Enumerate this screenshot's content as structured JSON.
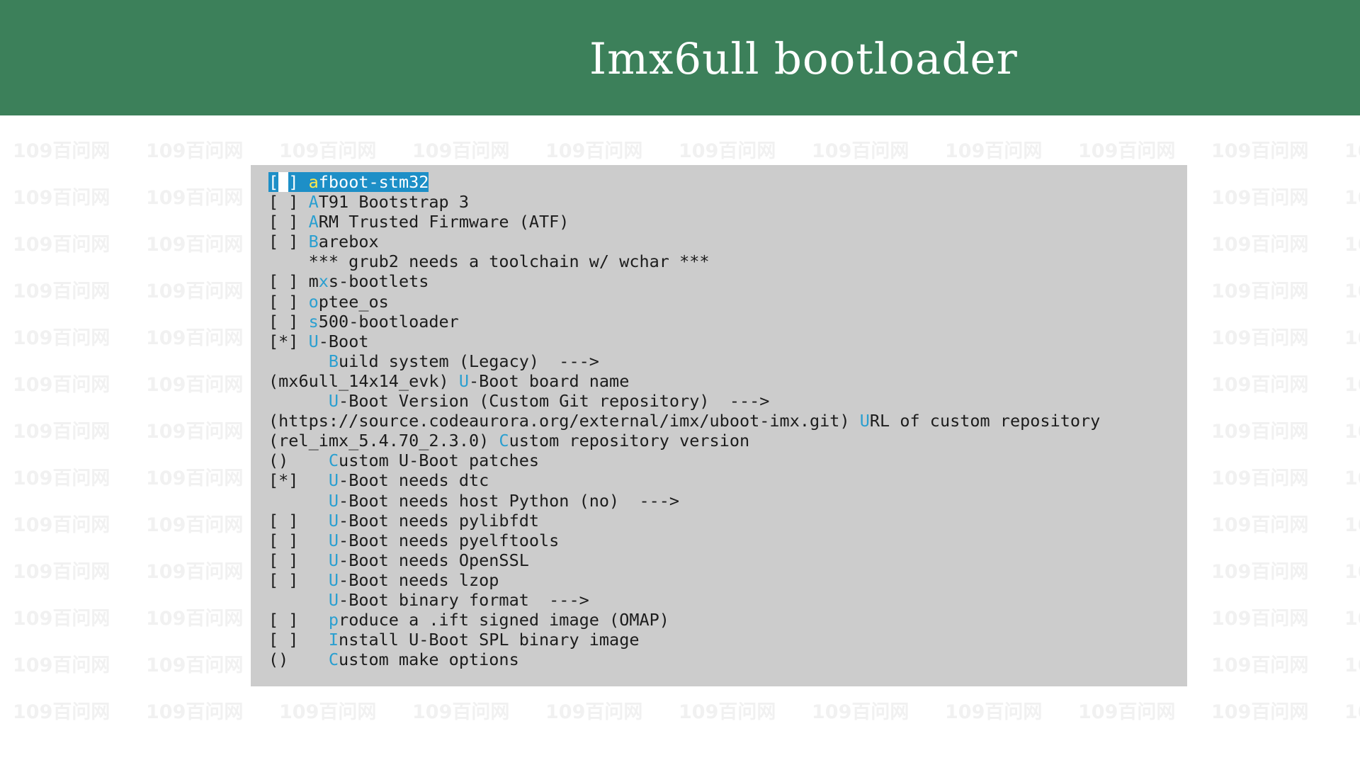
{
  "header": {
    "title": "Imx6ull bootloader",
    "background_color": "#3c805a"
  },
  "watermark": {
    "text": "109百问网"
  },
  "terminal": {
    "background_color": "#cccccc",
    "hotkey_color": "#2a9fd0",
    "selection_color": "#1d8fc7",
    "items": [
      {
        "prefix": "[ ] ",
        "hot": "a",
        "rest": "fboot-stm32",
        "selected": true
      },
      {
        "prefix": "[ ] ",
        "hot": "A",
        "rest": "T91 Bootstrap 3"
      },
      {
        "prefix": "[ ] ",
        "hot": "A",
        "rest": "RM Trusted Firmware (ATF)"
      },
      {
        "prefix": "[ ] ",
        "hot": "B",
        "rest": "arebox"
      },
      {
        "prefix": "    ",
        "hot": "",
        "rest": "*** grub2 needs a toolchain w/ wchar ***"
      },
      {
        "prefix": "[ ] ",
        "hot": "",
        "pre": "m",
        "hot2": "x",
        "rest": "s-bootlets"
      },
      {
        "prefix": "[ ] ",
        "hot": "o",
        "rest": "ptee_os"
      },
      {
        "prefix": "[ ] ",
        "hot": "s",
        "rest": "500-bootloader"
      },
      {
        "prefix": "[*] ",
        "hot": "U",
        "rest": "-Boot"
      },
      {
        "prefix": "      ",
        "hot": "B",
        "rest": "uild system (Legacy)  --->"
      },
      {
        "prefix": "(mx6ull_14x14_evk) ",
        "hot": "U",
        "rest": "-Boot board name"
      },
      {
        "prefix": "      ",
        "hot": "U",
        "rest": "-Boot Version (Custom Git repository)  --->"
      },
      {
        "prefix": "(https://source.codeaurora.org/external/imx/uboot-imx.git) ",
        "hot": "U",
        "rest": "RL of custom repository"
      },
      {
        "prefix": "(rel_imx_5.4.70_2.3.0) ",
        "hot": "C",
        "rest": "ustom repository version"
      },
      {
        "prefix": "()    ",
        "hot": "C",
        "rest": "ustom U-Boot patches"
      },
      {
        "prefix": "[*]   ",
        "hot": "U",
        "rest": "-Boot needs dtc"
      },
      {
        "prefix": "      ",
        "hot": "U",
        "rest": "-Boot needs host Python (no)  --->"
      },
      {
        "prefix": "[ ]   ",
        "hot": "U",
        "rest": "-Boot needs pylibfdt"
      },
      {
        "prefix": "[ ]   ",
        "hot": "U",
        "rest": "-Boot needs pyelftools"
      },
      {
        "prefix": "[ ]   ",
        "hot": "U",
        "rest": "-Boot needs OpenSSL"
      },
      {
        "prefix": "[ ]   ",
        "hot": "U",
        "rest": "-Boot needs lzop"
      },
      {
        "prefix": "      ",
        "hot": "U",
        "rest": "-Boot binary format  --->"
      },
      {
        "prefix": "[ ]   ",
        "hot": "p",
        "rest": "roduce a .ift signed image (OMAP)"
      },
      {
        "prefix": "[ ]   ",
        "hot": "I",
        "rest": "nstall U-Boot SPL binary image"
      },
      {
        "prefix": "()    ",
        "hot": "C",
        "rest": "ustom make options"
      }
    ]
  }
}
